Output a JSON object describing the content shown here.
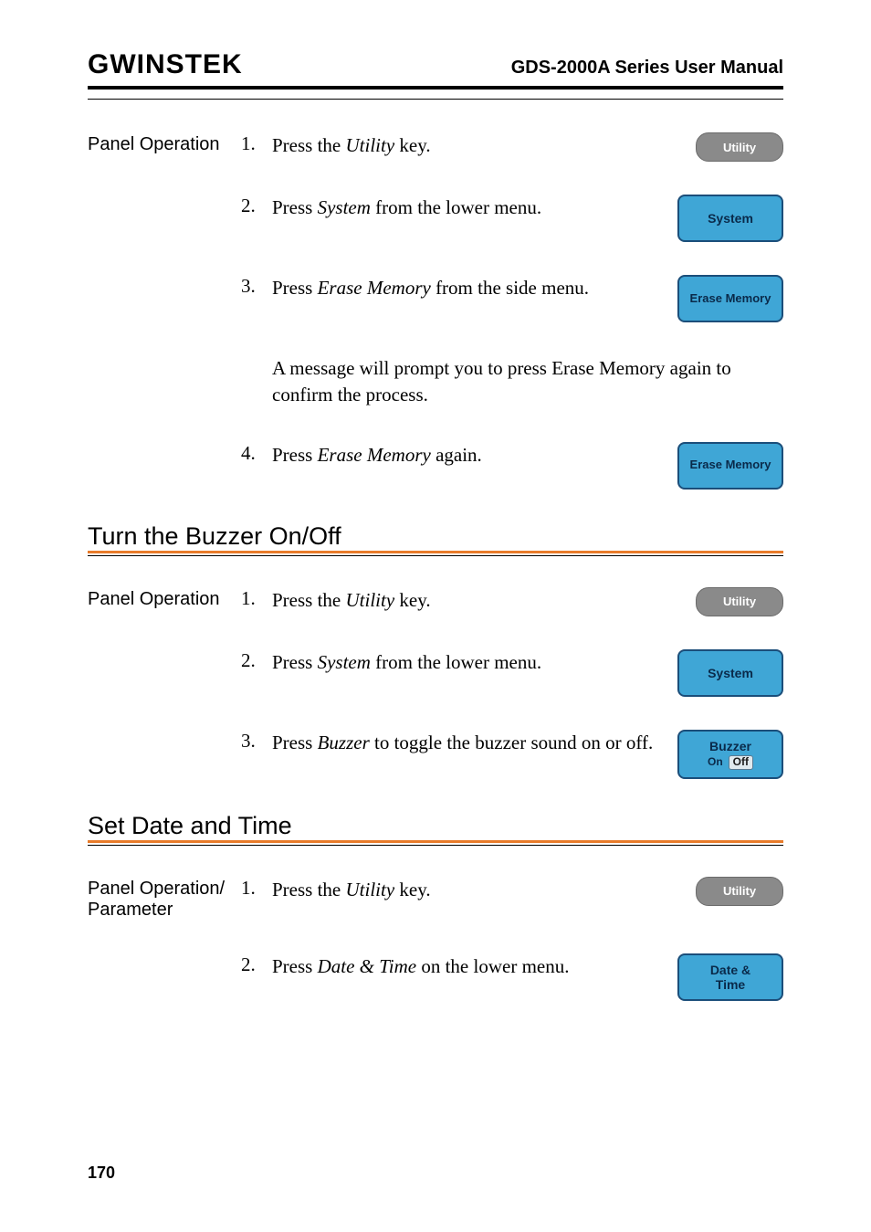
{
  "header": {
    "logo": "GWINSTEK",
    "title": "GDS-2000A Series User Manual"
  },
  "section1": {
    "label": "Panel Operation",
    "steps": [
      {
        "n": "1.",
        "pre": "Press the ",
        "em": "Utility",
        "post": " key.",
        "btn_type": "grey",
        "btn": "Utility"
      },
      {
        "n": "2.",
        "pre": "Press ",
        "em": "System",
        "post": " from the lower menu.",
        "btn_type": "blue",
        "btn": "System"
      },
      {
        "n": "3.",
        "pre": "Press ",
        "em": "Erase Memory",
        "post": " from the side menu.",
        "btn_type": "blue",
        "btn": "Erase Memory"
      }
    ],
    "note": "A message will prompt you to press Erase Memory again to confirm the process.",
    "steps2": [
      {
        "n": "4.",
        "pre": "Press ",
        "em": "Erase Memory",
        "post": " again.",
        "btn_type": "blue",
        "btn": "Erase Memory"
      }
    ]
  },
  "section2": {
    "heading": "Turn the Buzzer On/Off",
    "label": "Panel Operation",
    "steps": [
      {
        "n": "1.",
        "pre": "Press the ",
        "em": "Utility",
        "post": " key.",
        "btn_type": "grey",
        "btn": "Utility"
      },
      {
        "n": "2.",
        "pre": "Press ",
        "em": "System",
        "post": " from the lower menu.",
        "btn_type": "blue",
        "btn": "System"
      },
      {
        "n": "3.",
        "pre": "Press ",
        "em": "Buzzer",
        "post": " to toggle the buzzer sound on or off.",
        "btn_type": "toggle",
        "btn": "Buzzer",
        "opt1": "On",
        "opt2": "Off"
      }
    ]
  },
  "section3": {
    "heading": "Set Date and Time",
    "label": "Panel Operation/ Parameter",
    "steps": [
      {
        "n": "1.",
        "pre": "Press the ",
        "em": "Utility",
        "post": " key.",
        "btn_type": "grey",
        "btn": "Utility"
      },
      {
        "n": "2.",
        "pre": "Press ",
        "em": "Date & Time",
        "post": " on the lower menu.",
        "btn_type": "blue2",
        "btn1": "Date &",
        "btn2": "Time"
      }
    ]
  },
  "page": "170"
}
